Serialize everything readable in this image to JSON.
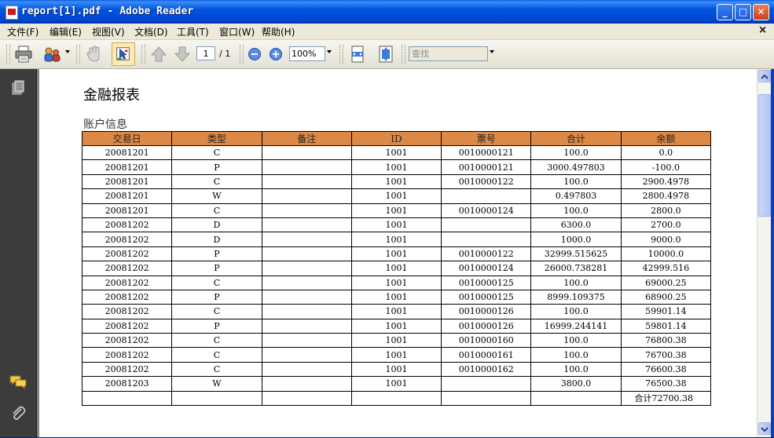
{
  "window": {
    "title": "report[1].pdf - Adobe Reader",
    "minimize_label": "_",
    "maximize_label": "□",
    "close_label": "✕"
  },
  "menu": {
    "items": [
      "文件(F)",
      "编辑(E)",
      "视图(V)",
      "文档(D)",
      "工具(T)",
      "窗口(W)",
      "帮助(H)"
    ],
    "doc_close": "×"
  },
  "toolbar": {
    "page_number": "1",
    "page_total": "/ 1",
    "zoom": "100%",
    "search_placeholder": "查找",
    "icons": [
      "print-icon",
      "share-icon",
      "hand-tool-icon",
      "select-tool-icon",
      "prev-page-icon",
      "next-page-icon",
      "zoom-out-icon",
      "zoom-in-icon",
      "fit-width-icon",
      "fit-page-icon"
    ]
  },
  "nav": {
    "icons": [
      "pages-icon",
      "comments-icon",
      "attachments-icon"
    ]
  },
  "report": {
    "title": "金融报表",
    "section_title": "账户信息",
    "columns": [
      "交易日",
      "类型",
      "备注",
      "ID",
      "票号",
      "合计",
      "余额"
    ],
    "rows": [
      [
        "20081201",
        "C",
        "",
        "1001",
        "0010000121",
        "100.0",
        "0.0"
      ],
      [
        "20081201",
        "P",
        "",
        "1001",
        "0010000121",
        "3000.497803",
        "-100.0"
      ],
      [
        "20081201",
        "C",
        "",
        "1001",
        "0010000122",
        "100.0",
        "2900.4978"
      ],
      [
        "20081201",
        "W",
        "",
        "1001",
        "",
        "0.497803",
        "2800.4978"
      ],
      [
        "20081201",
        "C",
        "",
        "1001",
        "0010000124",
        "100.0",
        "2800.0"
      ],
      [
        "20081202",
        "D",
        "",
        "1001",
        "",
        "6300.0",
        "2700.0"
      ],
      [
        "20081202",
        "D",
        "",
        "1001",
        "",
        "1000.0",
        "9000.0"
      ],
      [
        "20081202",
        "P",
        "",
        "1001",
        "0010000122",
        "32999.515625",
        "10000.0"
      ],
      [
        "20081202",
        "P",
        "",
        "1001",
        "0010000124",
        "26000.738281",
        "42999.516"
      ],
      [
        "20081202",
        "C",
        "",
        "1001",
        "0010000125",
        "100.0",
        "69000.25"
      ],
      [
        "20081202",
        "P",
        "",
        "1001",
        "0010000125",
        "8999.109375",
        "68900.25"
      ],
      [
        "20081202",
        "C",
        "",
        "1001",
        "0010000126",
        "100.0",
        "59901.14"
      ],
      [
        "20081202",
        "P",
        "",
        "1001",
        "0010000126",
        "16999.244141",
        "59801.14"
      ],
      [
        "20081202",
        "C",
        "",
        "1001",
        "0010000160",
        "100.0",
        "76800.38"
      ],
      [
        "20081202",
        "C",
        "",
        "1001",
        "0010000161",
        "100.0",
        "76700.38"
      ],
      [
        "20081202",
        "C",
        "",
        "1001",
        "0010000162",
        "100.0",
        "76600.38"
      ],
      [
        "20081203",
        "W",
        "",
        "1001",
        "",
        "3800.0",
        "76500.38"
      ]
    ],
    "total_label": "合计72700.38"
  },
  "colors": {
    "header_bg": "#dd8844",
    "titlebar": "#0053e0",
    "nav_bg": "#3c3c3c"
  }
}
